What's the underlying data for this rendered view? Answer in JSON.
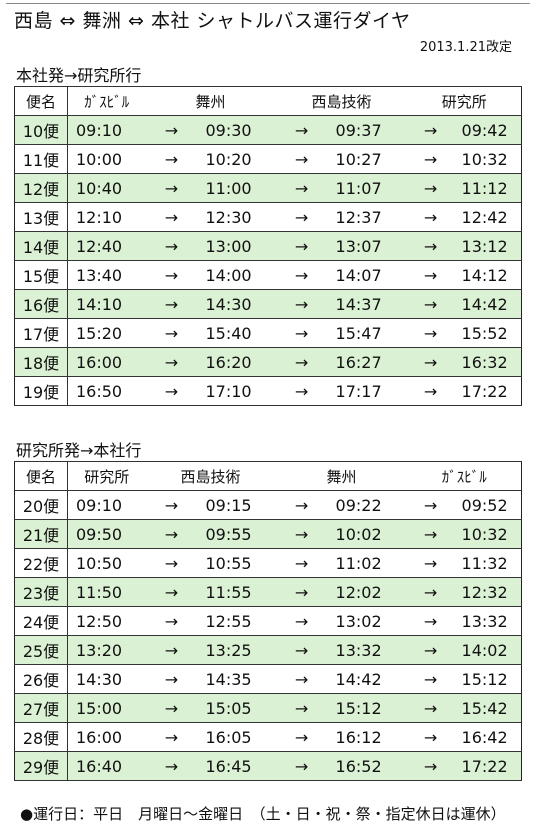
{
  "title": "西島 ⇔ 舞洲 ⇔ 本社 シャトルバス運行ダイヤ",
  "revised": "2013.1.21改定",
  "colors": {
    "shaded_row": "#daf1d3",
    "border": "#333333"
  },
  "outbound": {
    "title": "本社発→研究所行",
    "headers": [
      "便名",
      "ｶﾞｽﾋﾞﾙ",
      "舞州",
      "西島技術",
      "研究所"
    ],
    "rows": [
      {
        "no": "10便",
        "times": [
          "09:10",
          "09:30",
          "09:37",
          "09:42"
        ],
        "shaded": true
      },
      {
        "no": "11便",
        "times": [
          "10:00",
          "10:20",
          "10:27",
          "10:32"
        ],
        "shaded": false
      },
      {
        "no": "12便",
        "times": [
          "10:40",
          "11:00",
          "11:07",
          "11:12"
        ],
        "shaded": true
      },
      {
        "no": "13便",
        "times": [
          "12:10",
          "12:30",
          "12:37",
          "12:42"
        ],
        "shaded": false
      },
      {
        "no": "14便",
        "times": [
          "12:40",
          "13:00",
          "13:07",
          "13:12"
        ],
        "shaded": true
      },
      {
        "no": "15便",
        "times": [
          "13:40",
          "14:00",
          "14:07",
          "14:12"
        ],
        "shaded": false
      },
      {
        "no": "16便",
        "times": [
          "14:10",
          "14:30",
          "14:37",
          "14:42"
        ],
        "shaded": true
      },
      {
        "no": "17便",
        "times": [
          "15:20",
          "15:40",
          "15:47",
          "15:52"
        ],
        "shaded": false
      },
      {
        "no": "18便",
        "times": [
          "16:00",
          "16:20",
          "16:27",
          "16:32"
        ],
        "shaded": true
      },
      {
        "no": "19便",
        "times": [
          "16:50",
          "17:10",
          "17:17",
          "17:22"
        ],
        "shaded": false
      }
    ]
  },
  "inbound": {
    "title": "研究所発→本社行",
    "headers": [
      "便名",
      "研究所",
      "西島技術",
      "舞州",
      "ｶﾞｽﾋﾞﾙ"
    ],
    "rows": [
      {
        "no": "20便",
        "times": [
          "09:10",
          "09:15",
          "09:22",
          "09:52"
        ],
        "shaded": false
      },
      {
        "no": "21便",
        "times": [
          "09:50",
          "09:55",
          "10:02",
          "10:32"
        ],
        "shaded": true
      },
      {
        "no": "22便",
        "times": [
          "10:50",
          "10:55",
          "11:02",
          "11:32"
        ],
        "shaded": false
      },
      {
        "no": "23便",
        "times": [
          "11:50",
          "11:55",
          "12:02",
          "12:32"
        ],
        "shaded": true
      },
      {
        "no": "24便",
        "times": [
          "12:50",
          "12:55",
          "13:02",
          "13:32"
        ],
        "shaded": false
      },
      {
        "no": "25便",
        "times": [
          "13:20",
          "13:25",
          "13:32",
          "14:02"
        ],
        "shaded": true
      },
      {
        "no": "26便",
        "times": [
          "14:30",
          "14:35",
          "14:42",
          "15:12"
        ],
        "shaded": false
      },
      {
        "no": "27便",
        "times": [
          "15:00",
          "15:05",
          "15:12",
          "15:42"
        ],
        "shaded": true
      },
      {
        "no": "28便",
        "times": [
          "16:00",
          "16:05",
          "16:12",
          "16:42"
        ],
        "shaded": false
      },
      {
        "no": "29便",
        "times": [
          "16:40",
          "16:45",
          "16:52",
          "17:22"
        ],
        "shaded": true
      }
    ]
  },
  "arrow": "→",
  "note": "●運行日：平日　月曜日～金曜日　（土・日・祝・祭・指定休日は運休）"
}
